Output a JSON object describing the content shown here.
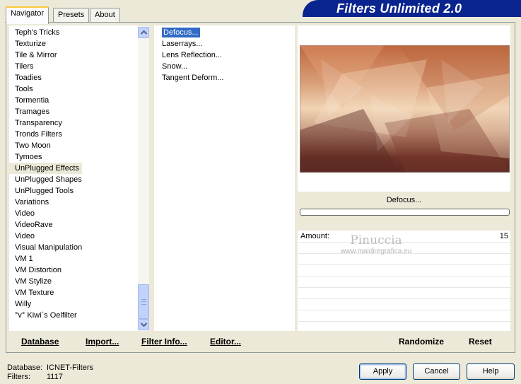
{
  "tabs": [
    {
      "label": "Navigator",
      "active": true
    },
    {
      "label": "Presets",
      "active": false
    },
    {
      "label": "About",
      "active": false
    }
  ],
  "title": "Filters Unlimited 2.0",
  "categories": [
    "Teph's Tricks",
    "Texturize",
    "Tile & Mirror",
    "Tilers",
    "Toadies",
    "Tools",
    "Tormentia",
    "Tramages",
    "Transparency",
    "Tronds Filters",
    "Two Moon",
    "Tymoes",
    "UnPlugged Effects",
    "UnPlugged Shapes",
    "UnPlugged Tools",
    "Variations",
    "Video",
    "VideoRave",
    "Video",
    "Visual Manipulation",
    "VM 1",
    "VM Distortion",
    "VM Stylize",
    "VM Texture",
    "Willy",
    "°v° Kiwi`s Oelfilter"
  ],
  "selected_category": "UnPlugged Effects",
  "filters": [
    "Defocus...",
    "Laserrays...",
    "Lens Reflection...",
    "Snow...",
    "Tangent Deform..."
  ],
  "selected_filter": "Defocus...",
  "preview": {
    "filter_name": "Defocus..."
  },
  "parameters": [
    {
      "label": "Amount:",
      "value": "15"
    },
    {
      "label": "",
      "value": ""
    },
    {
      "label": "",
      "value": ""
    },
    {
      "label": "",
      "value": ""
    },
    {
      "label": "",
      "value": ""
    },
    {
      "label": "",
      "value": ""
    },
    {
      "label": "",
      "value": ""
    },
    {
      "label": "",
      "value": ""
    }
  ],
  "watermark": {
    "name": "Pinuccia",
    "url": "www.maidiregrafica.eu"
  },
  "toolbar": {
    "database": "Database",
    "import": "Import...",
    "filter_info": "Filter Info...",
    "editor": "Editor...",
    "randomize": "Randomize",
    "reset": "Reset"
  },
  "status": {
    "database_label": "Database:",
    "database_value": "ICNET-Filters",
    "filters_label": "Filters:",
    "filters_value": "1117"
  },
  "buttons": {
    "apply": "Apply",
    "cancel": "Cancel",
    "help": "Help"
  },
  "colors": {
    "banner": "#0a248f",
    "selection": "#316ac5",
    "panel": "#ece9d8"
  },
  "icons": {
    "scroll_up": "chevron-up-icon",
    "scroll_down": "chevron-down-icon"
  }
}
